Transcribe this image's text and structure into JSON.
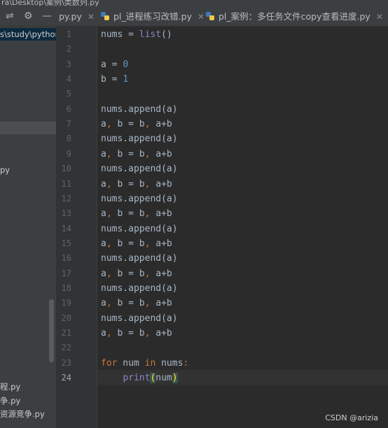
{
  "window": {
    "title": "ra\\Desktop\\案例\\类数列.py"
  },
  "toolbar": {
    "divider_icon": "split-icon",
    "settings_icon": "gear-icon",
    "minimize_icon": "minus-icon"
  },
  "tabs": [
    {
      "label": "py.py",
      "active": false
    },
    {
      "label": "pl_进程练习改错.py",
      "active": false
    },
    {
      "label": "pl_案例：多任务文件copy查看进度.py",
      "active": false
    }
  ],
  "project_tree": {
    "path": "s\\study\\python",
    "items": [
      "py",
      "程.py",
      "争.py",
      "资源竞争.py"
    ]
  },
  "editor": {
    "lines": [
      "nums = list()",
      "",
      "a = 0",
      "b = 1",
      "",
      "nums.append(a)",
      "a, b = b, a+b",
      "nums.append(a)",
      "a, b = b, a+b",
      "nums.append(a)",
      "a, b = b, a+b",
      "nums.append(a)",
      "a, b = b, a+b",
      "nums.append(a)",
      "a, b = b, a+b",
      "nums.append(a)",
      "a, b = b, a+b",
      "nums.append(a)",
      "a, b = b, a+b",
      "nums.append(a)",
      "a, b = b, a+b",
      "",
      "for num in nums:",
      "    print(num)"
    ],
    "current_line": 24
  },
  "watermark": "CSDN @arizia",
  "colors": {
    "keyword": "#cc7832",
    "number": "#6897bb",
    "builtin": "#8888c6",
    "text": "#a9b7c6"
  }
}
